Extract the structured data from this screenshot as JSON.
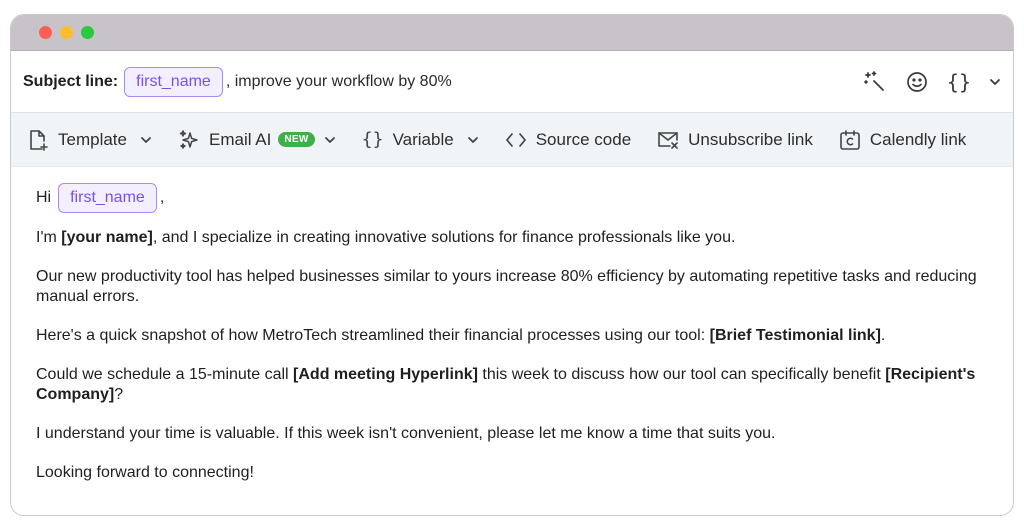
{
  "window": {
    "dots": [
      "#ff5f57",
      "#febc2e",
      "#28c840"
    ]
  },
  "subject": {
    "label": "Subject line:",
    "variable": "first_name",
    "text": ", improve your workflow by 80%",
    "actions": [
      "magic-wand-icon",
      "smiley-icon",
      "braces-icon",
      "chevron-down-icon"
    ]
  },
  "toolbar": {
    "template": "Template",
    "email_ai": "Email AI",
    "new_badge": "NEW",
    "variable": "Variable",
    "source_code": "Source code",
    "unsubscribe": "Unsubscribe link",
    "calendly": "Calendly link"
  },
  "body": {
    "greeting": "Hi",
    "greeting_var": "first_name",
    "greeting_comma": ",",
    "p1_a": "I'm ",
    "p1_b": "[your name]",
    "p1_c": ", and I specialize in creating innovative solutions for finance professionals like you.",
    "p2": "Our new productivity tool has helped businesses similar to yours increase 80% efficiency by automating repetitive tasks and reducing manual errors.",
    "p3_a": "Here's a quick snapshot of how MetroTech streamlined their financial processes using our tool: ",
    "p3_b": "[Brief Testimonial link]",
    "p3_c": ".",
    "p4_a": "Could we schedule a 15-minute call ",
    "p4_b": "[Add meeting Hyperlink]",
    "p4_c": " this week to discuss how our tool can specifically benefit ",
    "p4_d": "[Recipient's Company]",
    "p4_e": "?",
    "p5": "I understand your time is valuable. If this week isn't convenient, please let me know a time that suits you.",
    "p6": "Looking forward to connecting!"
  },
  "colors": {
    "chip_border": "#a58cf2",
    "chip_text": "#7653e4",
    "badge": "#3db04a",
    "toolbar_bg": "#f1f4f7"
  }
}
